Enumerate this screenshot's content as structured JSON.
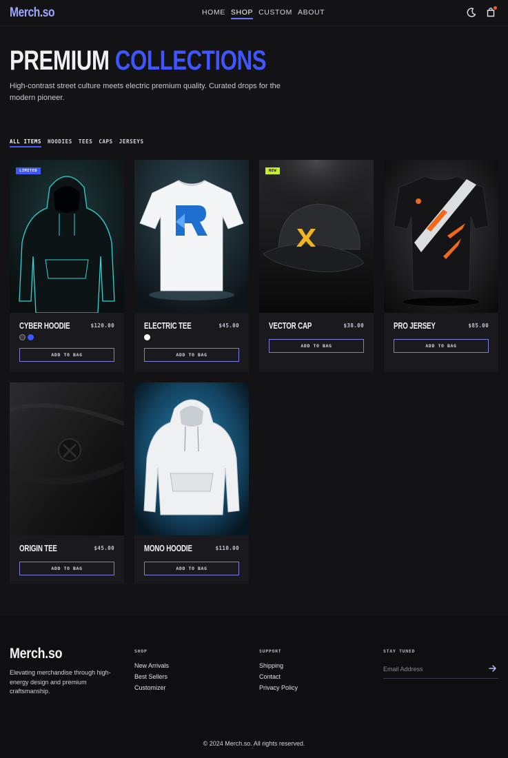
{
  "header": {
    "logo": "Merch.so",
    "nav": [
      {
        "label": "HOME",
        "active": false
      },
      {
        "label": "SHOP",
        "active": true
      },
      {
        "label": "CUSTOM",
        "active": false
      },
      {
        "label": "ABOUT",
        "active": false
      }
    ],
    "icons": [
      "moon-icon",
      "shopping-bag-icon"
    ]
  },
  "hero": {
    "title_word1": "PREMIUM",
    "title_word2": "COLLECTIONS",
    "subtitle": "High-contrast street culture meets electric premium quality. Curated drops for the modern pioneer."
  },
  "filters": [
    {
      "label": "ALL ITEMS",
      "active": true
    },
    {
      "label": "HOODIES",
      "active": false
    },
    {
      "label": "TEES",
      "active": false
    },
    {
      "label": "CAPS",
      "active": false
    },
    {
      "label": "JERSEYS",
      "active": false
    }
  ],
  "products": [
    {
      "name": "CYBER HOODIE",
      "price": "$120.00",
      "badge": "LIMITED",
      "swatches": [
        "#3a3a3a",
        "#3f56ff"
      ],
      "button": "ADD TO BAG"
    },
    {
      "name": "ELECTRIC TEE",
      "price": "$45.00",
      "badge": "",
      "swatches": [
        "#ffffff"
      ],
      "button": "ADD TO BAG"
    },
    {
      "name": "VECTOR CAP",
      "price": "$38.00",
      "badge": "NEW",
      "swatches": [],
      "button": "ADD TO BAG"
    },
    {
      "name": "PRO JERSEY",
      "price": "$85.00",
      "badge": "",
      "swatches": [],
      "button": "ADD TO BAG"
    },
    {
      "name": "ORIGIN TEE",
      "price": "$45.00",
      "badge": "",
      "swatches": [],
      "button": "ADD TO BAG"
    },
    {
      "name": "MONO HOODIE",
      "price": "$110.00",
      "badge": "",
      "swatches": [],
      "button": "ADD TO BAG"
    }
  ],
  "footer": {
    "logo": "Merch.so",
    "description": "Elevating merchandise through high-energy design and premium craftsmanship.",
    "shop": {
      "heading": "SHOP",
      "links": [
        "New Arrivals",
        "Best Sellers",
        "Customizer"
      ]
    },
    "support": {
      "heading": "SUPPORT",
      "links": [
        "Shipping",
        "Contact",
        "Privacy Policy"
      ]
    },
    "newsletter": {
      "heading": "STAY TUNED",
      "placeholder": "Email Address"
    },
    "copyright": "© 2024 Merch.so. All rights reserved."
  },
  "colors": {
    "accent": "#3f56ff",
    "badge_limited": "#3f56ff",
    "badge_new": "#c8f01e",
    "background": "#131215",
    "card": "#1a191e"
  }
}
